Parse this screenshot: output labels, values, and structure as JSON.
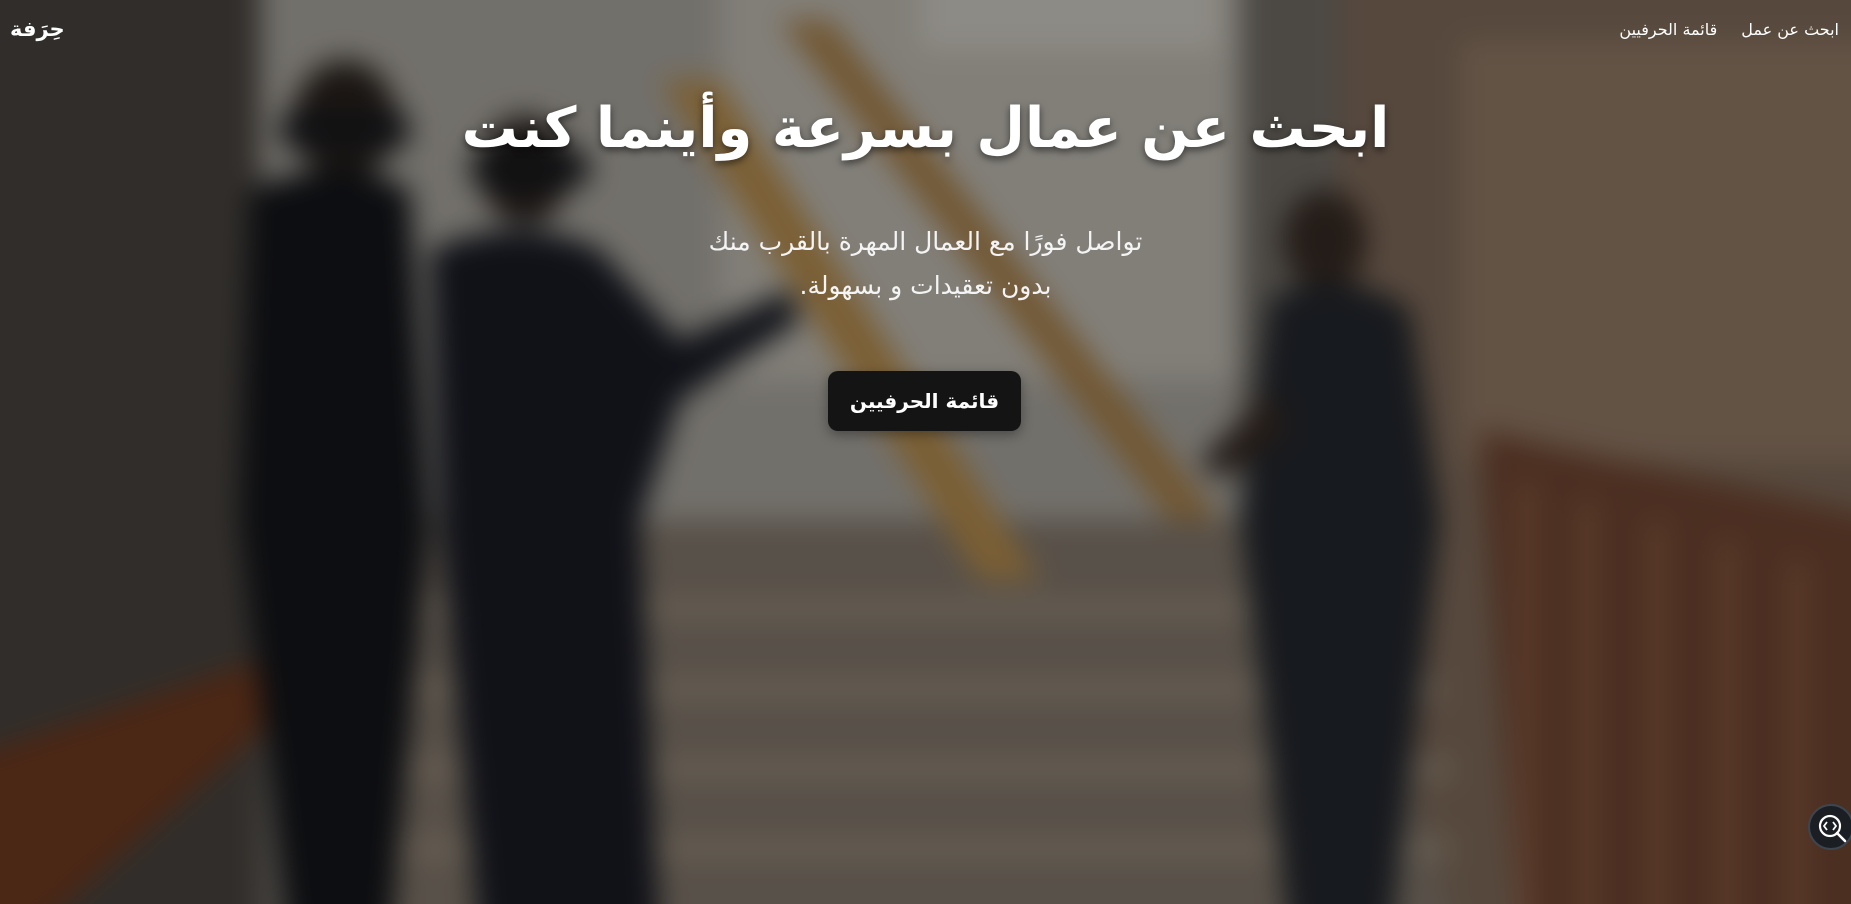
{
  "brand": {
    "name": "حِرَفة"
  },
  "nav": {
    "items": [
      {
        "label": "ابحث عن عمل"
      },
      {
        "label": "قائمة الحرفيين"
      }
    ]
  },
  "hero": {
    "title": "ابحث عن عمال بسرعة وأينما كنت",
    "subtitle_line1": "تواصل فورًا مع العمال المهرة بالقرب منك",
    "subtitle_line2": "بدون تعقيدات و بسهولة.",
    "cta_label": "قائمة الحرفيين"
  },
  "floating_tool": {
    "icon": "code-search-icon"
  },
  "colors": {
    "overlay": "#000000",
    "button_bg": "#141414",
    "text": "#ffffff"
  }
}
